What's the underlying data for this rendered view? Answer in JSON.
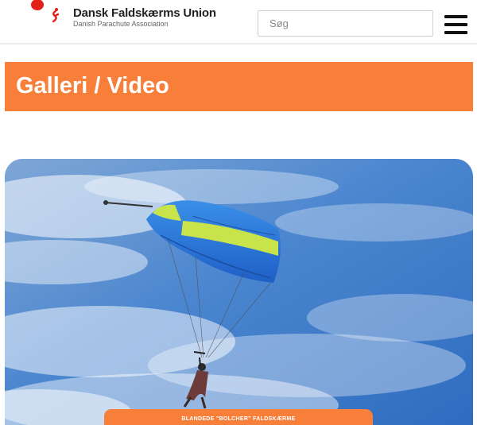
{
  "header": {
    "logo_icon": "parachutist-logo-icon",
    "brand_title": "Dansk Faldskærms Union",
    "brand_subtitle": "Danish Parachute Association",
    "search_placeholder": "Søg",
    "menu_icon": "hamburger-menu-icon"
  },
  "banner": {
    "title": "Galleri / Video",
    "color": "#f77f3a"
  },
  "hero": {
    "image": "parachute-canopy-photo",
    "caption": "BLANDEDE \"BOLCHER\" FALDSKÆRME"
  }
}
